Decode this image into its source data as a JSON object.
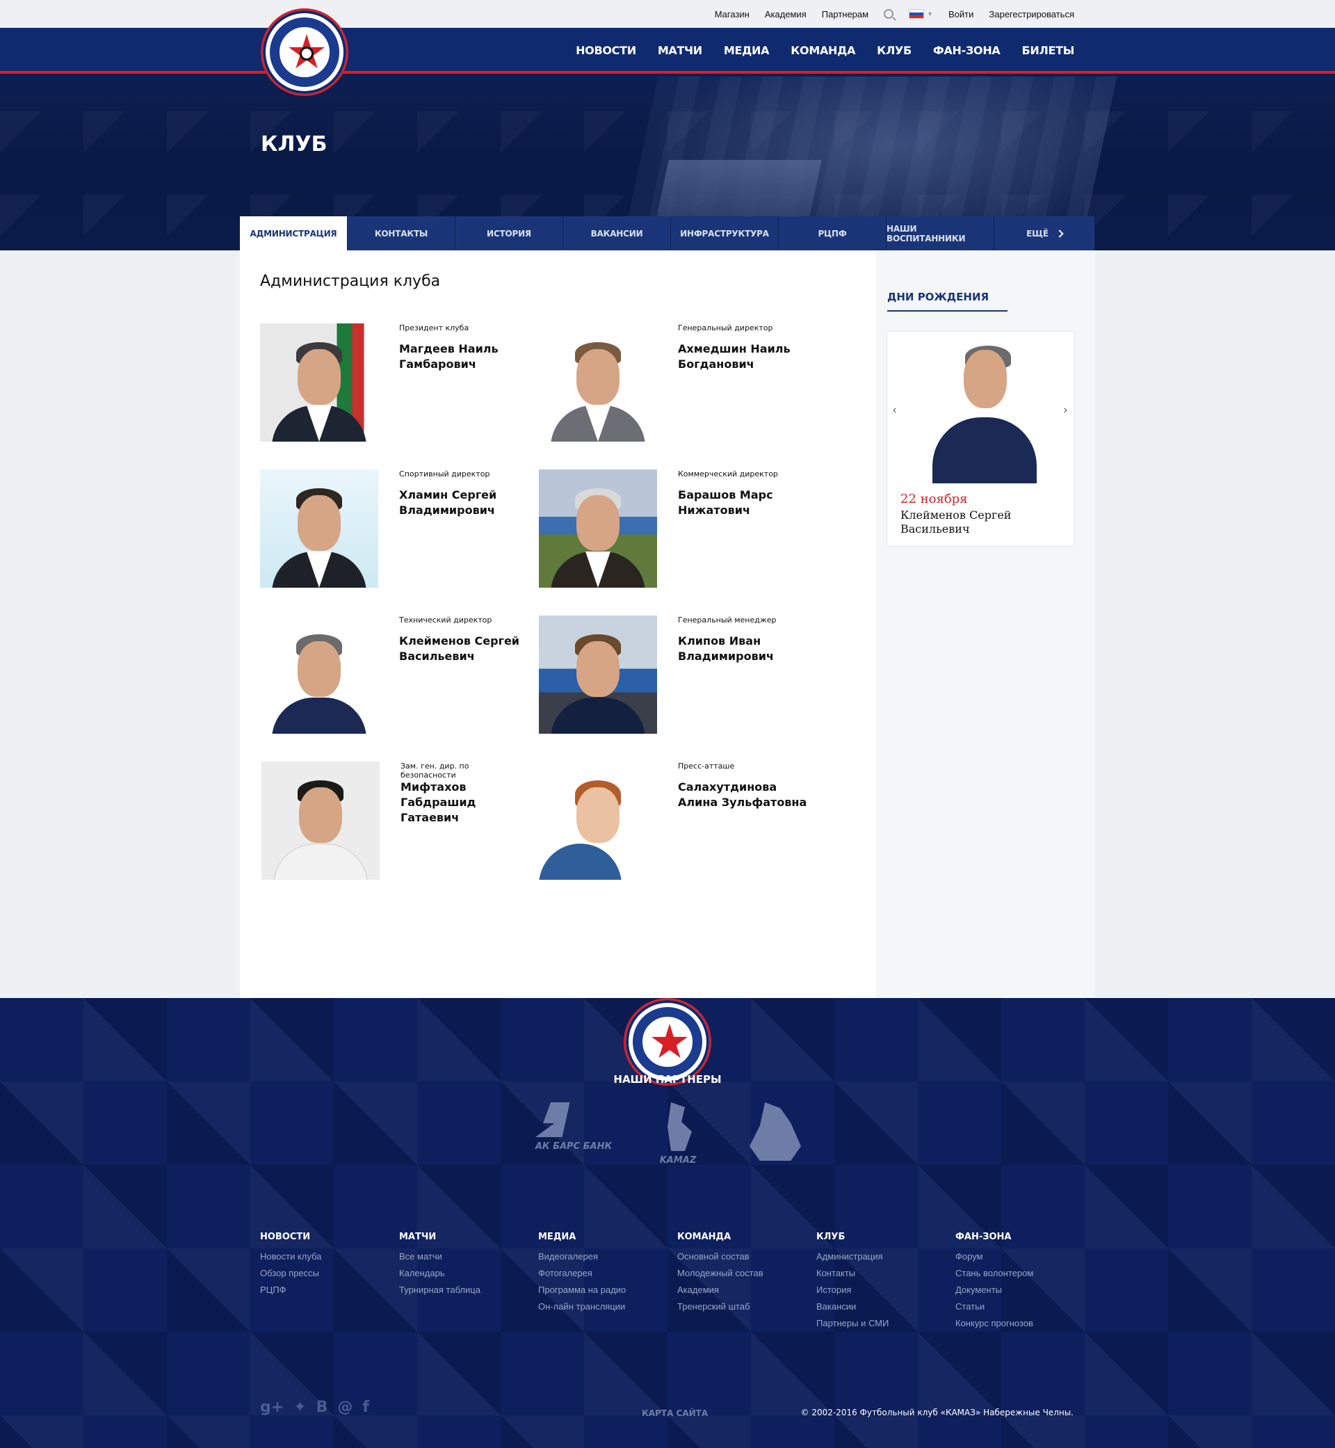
{
  "topbar": {
    "links": [
      "Магазин",
      "Академия",
      "Партнерам"
    ],
    "login": "Войти",
    "register": "Зарегестрироваться"
  },
  "nav": [
    "НОВОСТИ",
    "МАТЧИ",
    "МЕДИА",
    "КОМАНДА",
    "КЛУБ",
    "ФАН-ЗОНА",
    "БИЛЕТЫ"
  ],
  "nav_active": "КЛУБ",
  "page_title": "КЛУБ",
  "tabs": [
    "АДМИНИСТРАЦИЯ",
    "КОНТАКТЫ",
    "ИСТОРИЯ",
    "ВАКАНСИИ",
    "ИНФРАСТРУКТУРА",
    "РЦПФ",
    "НАШИ ВОСПИТАННИКИ"
  ],
  "tab_more": "ЕЩЁ",
  "main": {
    "heading": "Администрация клуба",
    "people": [
      {
        "role": "Президент клуба",
        "name": "Магдеев Наиль Гамбарович"
      },
      {
        "role": "Генеральный директор",
        "name": "Ахмедшин Наиль Богданович"
      },
      {
        "role": "Спортивный директор",
        "name": "Хламин Сергей Владимирович"
      },
      {
        "role": "Коммерческий директор",
        "name": "Барашов Марс Нижатович"
      },
      {
        "role": "Технический директор",
        "name": "Клейменов Сергей Васильевич"
      },
      {
        "role": "Генеральный менеджер",
        "name": "Клипов Иван Владимирович"
      },
      {
        "role": "Зам. ген. дир. по безопасности",
        "name": "Мифтахов Габдрашид Гатаевич"
      },
      {
        "role": "Пресс-атташе",
        "name": "Салахутдинова Алина Зульфатовна"
      }
    ]
  },
  "birthdays": {
    "title": "ДНИ РОЖДЕНИЯ",
    "date": "22 ноября",
    "name": "Клейменов Сергей Васильевич"
  },
  "footer": {
    "partners_title": "НАШИ ПАРТНЕРЫ",
    "partners": [
      "АК БАРС БАНК",
      "KAMAZ",
      ""
    ],
    "columns": [
      {
        "title": "НОВОСТИ",
        "links": [
          "Новости клуба",
          "Обзор прессы",
          "РЦПФ"
        ]
      },
      {
        "title": "МАТЧИ",
        "links": [
          "Все матчи",
          "Календарь",
          "Турнирная таблица"
        ]
      },
      {
        "title": "МЕДИА",
        "links": [
          "Видеогалерея",
          "Фотогалерея",
          "Программа на радио",
          "Он-лайн трансляции"
        ]
      },
      {
        "title": "КОМАНДА",
        "links": [
          "Основной состав",
          "Молодежный состав",
          "Академия",
          "Тренерский штаб"
        ]
      },
      {
        "title": "КЛУБ",
        "links": [
          "Администрация",
          "Контакты",
          "История",
          "Вакансии",
          "Партнеры и СМИ"
        ]
      },
      {
        "title": "ФАН-ЗОНА",
        "links": [
          "Форум",
          "Стань волонтером",
          "Документы",
          "Статьи",
          "Конкурс прогнозов"
        ]
      }
    ],
    "social": [
      "g+",
      "twitter-icon",
      "В",
      "@",
      "f"
    ],
    "sitemap": "КАРТА САЙТА",
    "copyright": "© 2002-2016 Футбольный клуб «КАМАЗ» Набережные Челны."
  }
}
